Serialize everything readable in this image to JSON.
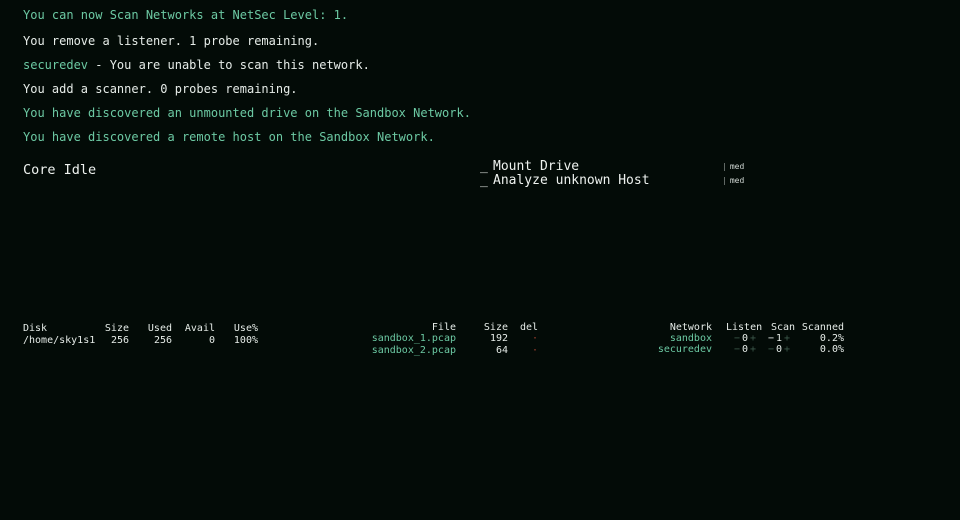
{
  "log": [
    {
      "text": "You can now Scan Networks at NetSec Level: 1.",
      "color": "teal"
    },
    {
      "text": "You remove a listener. 1 probe remaining.",
      "color": "white"
    },
    {
      "prefix": "securedev",
      "text": " - You are unable to scan this network.",
      "color": "white"
    },
    {
      "text": "You add a scanner. 0 probes remaining.",
      "color": "white"
    },
    {
      "text": "You have discovered an unmounted drive on the Sandbox Network.",
      "color": "teal"
    },
    {
      "text": "You have discovered a remote host on the Sandbox Network.",
      "color": "teal"
    }
  ],
  "core_status": "Core Idle",
  "tasks": [
    {
      "cursor": "_",
      "label": "Mount Drive",
      "priority": "med"
    },
    {
      "cursor": "_",
      "label": "Analyze unknown Host",
      "priority": "med"
    }
  ],
  "disk_table": {
    "headers": [
      "Disk",
      "Size",
      "Used",
      "Avail",
      "Use%"
    ],
    "rows": [
      [
        "/home/sky1s1",
        "256",
        "256",
        "0",
        "100%"
      ]
    ]
  },
  "file_table": {
    "headers": [
      "File",
      "Size",
      "del"
    ],
    "rows": [
      {
        "name": "sandbox_1.pcap",
        "size": "192",
        "del": "·"
      },
      {
        "name": "sandbox_2.pcap",
        "size": "64",
        "del": "·"
      }
    ]
  },
  "network_table": {
    "headers": [
      "Network",
      "Listen",
      "Scan",
      "Scanned"
    ],
    "rows": [
      {
        "name": "sandbox",
        "listen": "0",
        "scan": "1",
        "scanned": "0.2%"
      },
      {
        "name": "securedev",
        "listen": "0",
        "scan": "0",
        "scanned": "0.0%"
      }
    ],
    "dec": "−",
    "inc": "+"
  },
  "colors": {
    "background": "#030b07",
    "accent": "#6cc9a3",
    "text": "#e6ece8",
    "delete": "#a3412f"
  }
}
